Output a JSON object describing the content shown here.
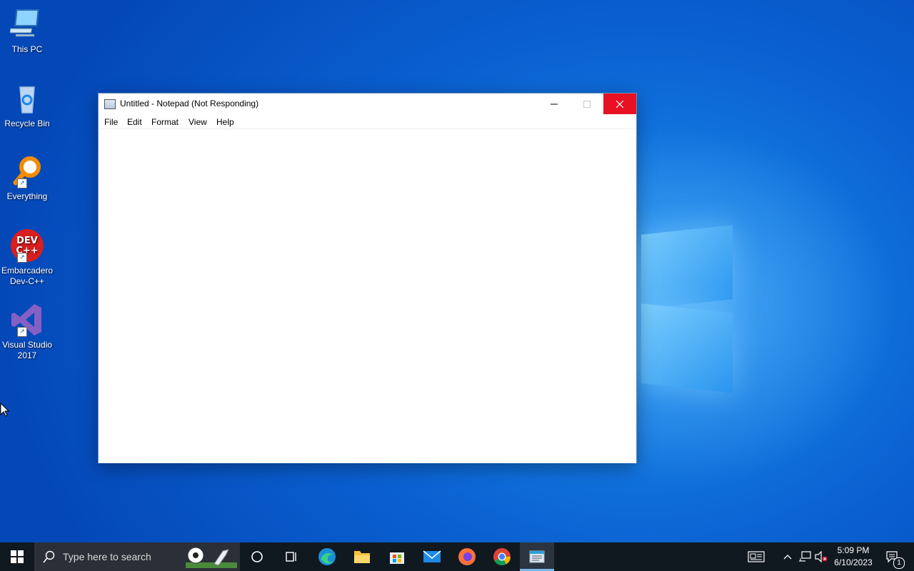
{
  "desktop": {
    "icons": [
      {
        "label": "This PC",
        "icon": "computer-icon"
      },
      {
        "label": "Recycle Bin",
        "icon": "recycle-bin-icon"
      },
      {
        "label": "Everything",
        "icon": "magnifier-icon"
      },
      {
        "label": "Embarcadero Dev-C++",
        "icon": "devcpp-icon",
        "glyph_text": "DEV C++"
      },
      {
        "label": "Visual Studio 2017",
        "icon": "visual-studio-icon"
      }
    ]
  },
  "notepad": {
    "title": "Untitled - Notepad (Not Responding)",
    "menu": [
      "File",
      "Edit",
      "Format",
      "View",
      "Help"
    ],
    "content": ""
  },
  "taskbar": {
    "search_placeholder": "Type here to search",
    "apps": [
      "cortana-icon",
      "task-view-icon",
      "edge-icon",
      "file-explorer-icon",
      "store-icon",
      "mail-icon",
      "firefox-icon",
      "chrome-icon",
      "notepad-icon"
    ],
    "clock_time": "5:09 PM",
    "clock_date": "6/10/2023",
    "notification_count": "1"
  },
  "colors": {
    "close_button": "#e81123",
    "taskbar": "#101820",
    "desktop_blue": "#0a5fd0"
  }
}
